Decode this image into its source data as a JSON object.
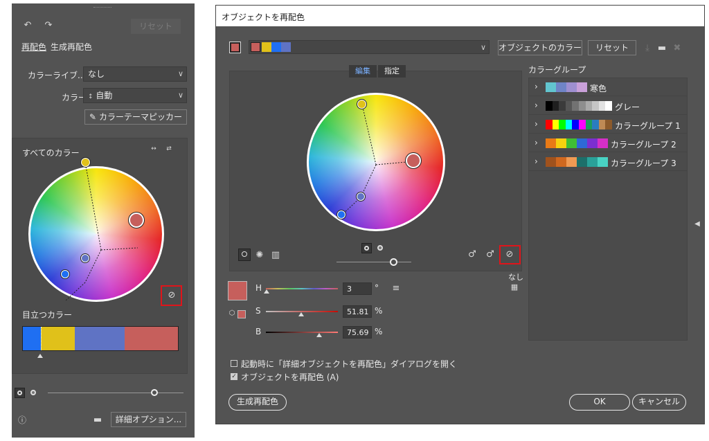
{
  "left_panel": {
    "undo_icon": "undo-icon",
    "redo_icon": "redo-icon",
    "reset_label": "リセット",
    "tab_recolor": "再配色",
    "tab_generative": "生成再配色",
    "color_library_label": "カラーライブ...",
    "color_library_value": "なし",
    "colors_label": "カラー :",
    "colors_value": "自動",
    "theme_picker_label": "カラーテーマピッカー",
    "all_colors_label": "すべてのカラー",
    "prominent_colors_label": "目立つカラー",
    "prominent_colors": [
      {
        "color": "#1f6ff2",
        "fraction": 0.115
      },
      {
        "color": "#e0c11a",
        "fraction": 0.22
      },
      {
        "color": "#5f73c4",
        "fraction": 0.32
      },
      {
        "color": "#c65f5c",
        "fraction": 0.345
      }
    ],
    "advanced_options_label": "詳細オプション..."
  },
  "dialog": {
    "title": "オブジェクトを再配色",
    "object_colors_label": "オブジェクトのカラー",
    "reset_label": "リセット",
    "current_group_colors": [
      "#c65f5c",
      "#e0c11a",
      "#1f6ff2",
      "#5f73c4"
    ],
    "tab_edit": "編集",
    "tab_assign": "指定",
    "color_groups_header": "カラーグループ",
    "color_groups": [
      {
        "name": "寒色",
        "colors": [
          "#62c5cf",
          "#6f84c6",
          "#9e8fd0",
          "#c9a0d9"
        ]
      },
      {
        "name": "グレー",
        "colors": [
          "#000000",
          "#1f1f1f",
          "#3b3b3b",
          "#565656",
          "#727272",
          "#8e8e8e",
          "#aaaaaa",
          "#c6c6c6",
          "#e2e2e2",
          "#ffffff"
        ]
      },
      {
        "name": "カラーグループ 1",
        "colors": [
          "#ff0000",
          "#ffff00",
          "#00ff00",
          "#00ffff",
          "#0000ff",
          "#ff00ff",
          "#1c9c5c",
          "#2a7cbf",
          "#bf8a55",
          "#8c5a2b"
        ]
      },
      {
        "name": "カラーグループ 2",
        "colors": [
          "#e87a16",
          "#f5d20f",
          "#3fbe34",
          "#2e69d6",
          "#7b2fd0",
          "#d52fc7"
        ]
      },
      {
        "name": "カラーグループ 3",
        "colors": [
          "#a0521d",
          "#d0681f",
          "#f09a53",
          "#1d6f6a",
          "#2aa199",
          "#49d3c4"
        ]
      }
    ],
    "none_label": "なし",
    "h_label": "H",
    "h_value": "3",
    "h_unit": "°",
    "s_label": "S",
    "s_value": "51.81",
    "s_unit": "%",
    "b_label": "B",
    "b_value": "75.69",
    "b_unit": "%",
    "base_color": "#c65f5c",
    "open_on_launch_label": "起動時に「詳細オブジェクトを再配色」ダイアログを開く",
    "open_on_launch_checked": false,
    "recolor_art_label": "オブジェクトを再配色 (A)",
    "recolor_art_checked": true,
    "generative_button_label": "生成再配色",
    "ok_label": "OK",
    "cancel_label": "キャンセル"
  }
}
